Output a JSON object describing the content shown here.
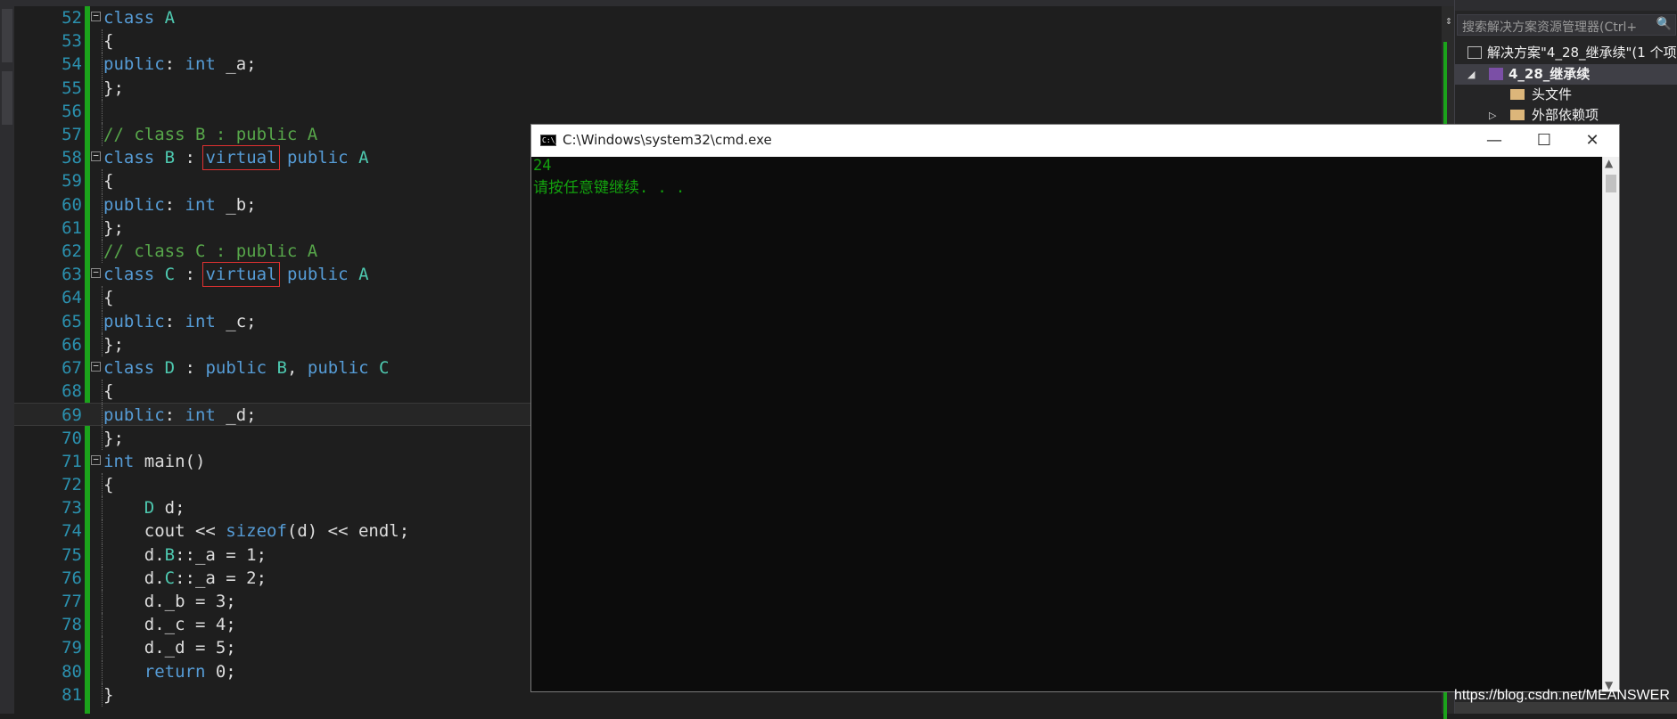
{
  "editor": {
    "lines": [
      {
        "n": "52",
        "fold": true,
        "html": "<span class='kw'>class</span> <span class='ty'>A</span>"
      },
      {
        "n": "53",
        "fold": false,
        "html": "{"
      },
      {
        "n": "54",
        "fold": false,
        "html": "<span class='kw'>public</span>: <span class='kw'>int</span> _a;"
      },
      {
        "n": "55",
        "fold": false,
        "html": "};"
      },
      {
        "n": "56",
        "fold": false,
        "html": ""
      },
      {
        "n": "57",
        "fold": false,
        "html": "<span class='cm'>// class B : public A</span>"
      },
      {
        "n": "58",
        "fold": true,
        "html": "<span class='kw'>class</span> <span class='ty'>B</span> : <span class='vir'>virtual</span> <span class='kw'>public</span> <span class='ty'>A</span>"
      },
      {
        "n": "59",
        "fold": false,
        "html": "{"
      },
      {
        "n": "60",
        "fold": false,
        "html": "<span class='kw'>public</span>: <span class='kw'>int</span> _b;"
      },
      {
        "n": "61",
        "fold": false,
        "html": "};"
      },
      {
        "n": "62",
        "fold": false,
        "html": "<span class='cm'>// class C : public A</span>"
      },
      {
        "n": "63",
        "fold": true,
        "html": "<span class='kw'>class</span> <span class='ty'>C</span> : <span class='vir'>virtual</span> <span class='kw'>public</span> <span class='ty'>A</span>"
      },
      {
        "n": "64",
        "fold": false,
        "html": "{"
      },
      {
        "n": "65",
        "fold": false,
        "html": "<span class='kw'>public</span>: <span class='kw'>int</span> _c;"
      },
      {
        "n": "66",
        "fold": false,
        "html": "};"
      },
      {
        "n": "67",
        "fold": true,
        "html": "<span class='kw'>class</span> <span class='ty'>D</span> : <span class='kw'>public</span> <span class='ty'>B</span>, <span class='kw'>public</span> <span class='ty'>C</span>"
      },
      {
        "n": "68",
        "fold": false,
        "html": "{"
      },
      {
        "n": "69",
        "fold": false,
        "current": true,
        "html": "<span class='kw'>public</span>: <span class='kw'>int</span> _d;"
      },
      {
        "n": "70",
        "fold": false,
        "html": "};"
      },
      {
        "n": "71",
        "fold": true,
        "html": "<span class='kw'>int</span> main()"
      },
      {
        "n": "72",
        "fold": false,
        "html": "{"
      },
      {
        "n": "73",
        "fold": false,
        "html": "    <span class='ty'>D</span> d;"
      },
      {
        "n": "74",
        "fold": false,
        "html": "    cout &lt;&lt; <span class='kw'>sizeof</span>(d) &lt;&lt; endl;"
      },
      {
        "n": "75",
        "fold": false,
        "html": "    d.<span class='ty'>B</span>::_a = 1;"
      },
      {
        "n": "76",
        "fold": false,
        "html": "    d.<span class='ty'>C</span>::_a = 2;"
      },
      {
        "n": "77",
        "fold": false,
        "html": "    d._b = 3;"
      },
      {
        "n": "78",
        "fold": false,
        "html": "    d._c = 4;"
      },
      {
        "n": "79",
        "fold": false,
        "html": "    d._d = 5;"
      },
      {
        "n": "80",
        "fold": false,
        "html": "    <span class='kw'>return</span> 0;"
      },
      {
        "n": "81",
        "fold": false,
        "html": "}"
      }
    ],
    "splitter_glyph": "⇕"
  },
  "solution_explorer": {
    "search_placeholder": "搜索解决方案资源管理器(Ctrl+",
    "search_icon": "🔍",
    "solution_label": "解决方案\"4_28_继承续\"(1 个项",
    "project_label": "4_28_继承续",
    "headers_label": "头文件",
    "external_deps_label": "外部依赖项"
  },
  "cmd": {
    "title": "C:\\Windows\\system32\\cmd.exe",
    "icon_text": "C:\\_",
    "minimize": "—",
    "maximize": "☐",
    "close": "✕",
    "output": [
      "24",
      "请按任意键继续. . ."
    ]
  },
  "watermark": "https://blog.csdn.net/MEANSWER",
  "colors": {
    "editor_bg": "#1e1e1e",
    "keyword": "#569cd6",
    "type": "#4ec9b0",
    "comment": "#57a64a",
    "line_number": "#2b91af",
    "cmd_text": "#13a10e",
    "highlight_box": "#e03131"
  }
}
